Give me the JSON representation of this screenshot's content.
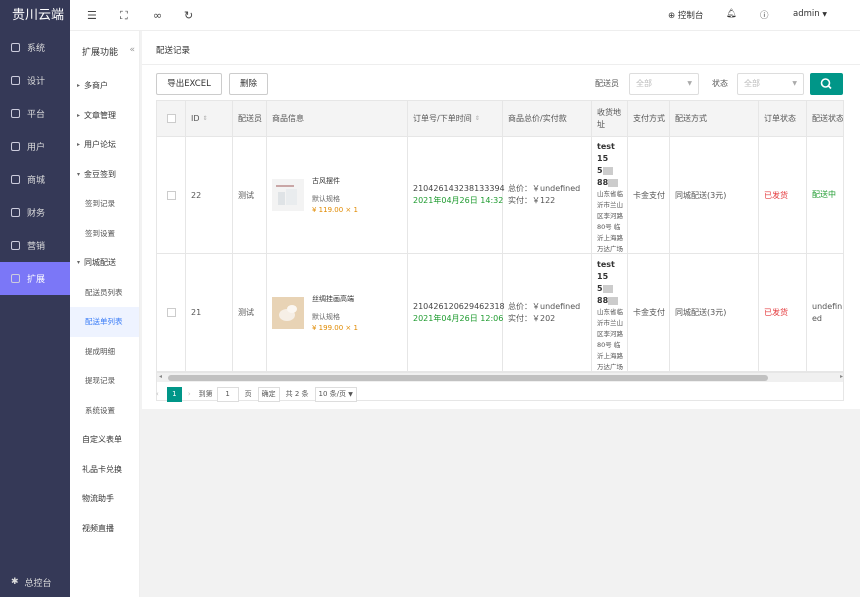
{
  "brand": "贵川云端",
  "sidebar": {
    "items": [
      {
        "label": "系统",
        "icon": "gear-icon"
      },
      {
        "label": "设计",
        "icon": "monitor-icon"
      },
      {
        "label": "平台",
        "icon": "laptop-icon"
      },
      {
        "label": "用户",
        "icon": "user-icon"
      },
      {
        "label": "商城",
        "icon": "shop-icon"
      },
      {
        "label": "财务",
        "icon": "wallet-icon"
      },
      {
        "label": "营销",
        "icon": "gift-icon"
      },
      {
        "label": "扩展",
        "icon": "grid-icon"
      }
    ],
    "footer": "总控台"
  },
  "subnav": {
    "title": "扩展功能",
    "collapse": "«",
    "items": [
      "多商户",
      "文章管理",
      "用户论坛",
      "金豆签到",
      "签到记录",
      "签到设置",
      "同城配送",
      "配送员列表",
      "配送单列表",
      "提成明细",
      "提现记录",
      "系统设置",
      "自定义表单",
      "礼品卡兑换",
      "物流助手",
      "视频直播"
    ]
  },
  "topbar": {
    "console": "控制台",
    "user": "admin",
    "icons": [
      "menu-icon",
      "fullscreen-icon",
      "link-icon",
      "refresh-icon"
    ]
  },
  "page": {
    "title": "配送记录",
    "export": "导出EXCEL",
    "delete": "删除",
    "filter": {
      "courier_label": "配送员",
      "courier_value": "全部",
      "status_label": "状态",
      "status_value": "全部"
    }
  },
  "table": {
    "headers": [
      "ID",
      "配送员",
      "商品信息",
      "订单号/下单时间",
      "商品总价/实付款",
      "收货地址",
      "支付方式",
      "配送方式",
      "订单状态",
      "配送状态"
    ],
    "rows": [
      {
        "id": "22",
        "courier": "测试",
        "goods": "古风摆件",
        "spec": "默认规格",
        "price": "¥ 119.00 × 1",
        "order_no": "210426143238133394",
        "time": "2021年04月26日 14:32",
        "total": "总价：￥undefined",
        "paid": "实付：￥122",
        "name": "test 15",
        "addr_a": "5",
        "addr_b": "88",
        "addr_rest": [
          "山东省临",
          "沂市兰山",
          "区李河路",
          "80号 临",
          "沂上海路",
          "万达广场"
        ],
        "pay": "卡金支付",
        "ship": "同城配送(3元)",
        "status": "已发货",
        "delivery": "配送中"
      },
      {
        "id": "21",
        "courier": "测试",
        "goods": "丝绸挂画高端",
        "spec": "默认规格",
        "price": "¥ 199.00 × 1",
        "order_no": "210426120629462318",
        "time": "2021年04月26日 12:06",
        "total": "总价：￥undefined",
        "paid": "实付：￥202",
        "name": "test 15",
        "addr_a": "5",
        "addr_b": "88",
        "addr_rest": [
          "山东省临",
          "沂市兰山",
          "区李河路",
          "80号 临",
          "沂上海路",
          "万达广场"
        ],
        "pay": "卡金支付",
        "ship": "同城配送(3元)",
        "status": "已发货",
        "delivery": "undefined"
      }
    ]
  },
  "pagination": {
    "current": "1",
    "goto_label": "到第",
    "page_value": "1",
    "page_unit": "页",
    "confirm": "确定",
    "total": "共 2 条",
    "per_page": "10 条/页"
  }
}
